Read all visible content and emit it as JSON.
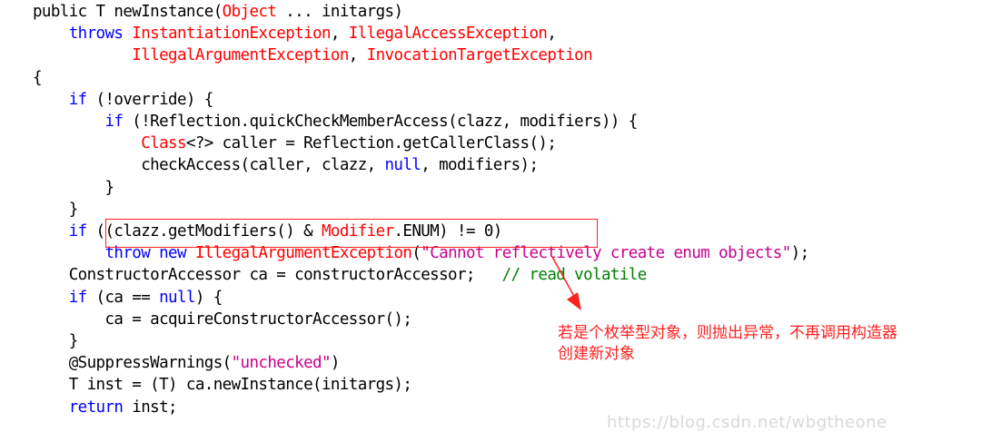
{
  "lines": [
    [
      [
        "public T newInstance(",
        "pl"
      ],
      [
        "Object",
        "ty"
      ],
      [
        " ... initargs)",
        "pl"
      ]
    ],
    [
      [
        "    throws ",
        "kw"
      ],
      [
        "InstantiationException",
        "ty"
      ],
      [
        ", ",
        "pl"
      ],
      [
        "IllegalAccessException",
        "ty"
      ],
      [
        ",",
        "pl"
      ]
    ],
    [
      [
        "           ",
        "pl"
      ],
      [
        "IllegalArgumentException",
        "ty"
      ],
      [
        ", ",
        "pl"
      ],
      [
        "InvocationTargetException",
        "ty"
      ]
    ],
    [
      [
        "{",
        "pl"
      ]
    ],
    [
      [
        "    ",
        "pl"
      ],
      [
        "if",
        "kw"
      ],
      [
        " (!override) {",
        "pl"
      ]
    ],
    [
      [
        "        ",
        "pl"
      ],
      [
        "if",
        "kw"
      ],
      [
        " (!Reflection.quickCheckMemberAccess(clazz, modifiers)) {",
        "pl"
      ]
    ],
    [
      [
        "            ",
        "pl"
      ],
      [
        "Class",
        "ty"
      ],
      [
        "<?> caller = Reflection.getCallerClass();",
        "pl"
      ]
    ],
    [
      [
        "            checkAccess(caller, clazz, ",
        "pl"
      ],
      [
        "null",
        "kw"
      ],
      [
        ", modifiers);",
        "pl"
      ]
    ],
    [
      [
        "        }",
        "pl"
      ]
    ],
    [
      [
        "    }",
        "pl"
      ]
    ],
    [
      [
        "    ",
        "pl"
      ],
      [
        "if",
        "kw"
      ],
      [
        " ((clazz.getModifiers() & ",
        "pl"
      ],
      [
        "Modifier",
        "ty"
      ],
      [
        ".ENUM) != 0)",
        "pl"
      ]
    ],
    [
      [
        "        ",
        "pl"
      ],
      [
        "throw",
        "kw"
      ],
      [
        " ",
        "pl"
      ],
      [
        "new",
        "kw"
      ],
      [
        " ",
        "pl"
      ],
      [
        "IllegalArgumentException",
        "ty"
      ],
      [
        "(",
        "pl"
      ],
      [
        "\"Cannot reflectively create enum objects\"",
        "str"
      ],
      [
        ");",
        "pl"
      ]
    ],
    [
      [
        "    ConstructorAccessor ca = constructorAccessor;   ",
        "pl"
      ],
      [
        "// read volatile",
        "cmt"
      ]
    ],
    [
      [
        "    ",
        "pl"
      ],
      [
        "if",
        "kw"
      ],
      [
        " (ca == ",
        "pl"
      ],
      [
        "null",
        "kw"
      ],
      [
        ") {",
        "pl"
      ]
    ],
    [
      [
        "        ca = acquireConstructorAccessor();",
        "pl"
      ]
    ],
    [
      [
        "    }",
        "pl"
      ]
    ],
    [
      [
        "    @SuppressWarnings(",
        "pl"
      ],
      [
        "\"unchecked\"",
        "str"
      ],
      [
        ")",
        "pl"
      ]
    ],
    [
      [
        "    T inst = (T) ca.newInstance(initargs);",
        "pl"
      ]
    ],
    [
      [
        "    ",
        "pl"
      ],
      [
        "return",
        "kw"
      ],
      [
        " inst;",
        "pl"
      ]
    ]
  ],
  "annotation": {
    "line1": "若是个枚举型对象，则抛出异常，不再调用构造器",
    "line2": "创建新对象"
  },
  "watermark": "https://blog.csdn.net/wbgtheone",
  "colors": {
    "keyword": "#0000ff",
    "type": "#ff0000",
    "string": "#c8008c",
    "comment": "#008000",
    "annotation": "#ff2020"
  }
}
